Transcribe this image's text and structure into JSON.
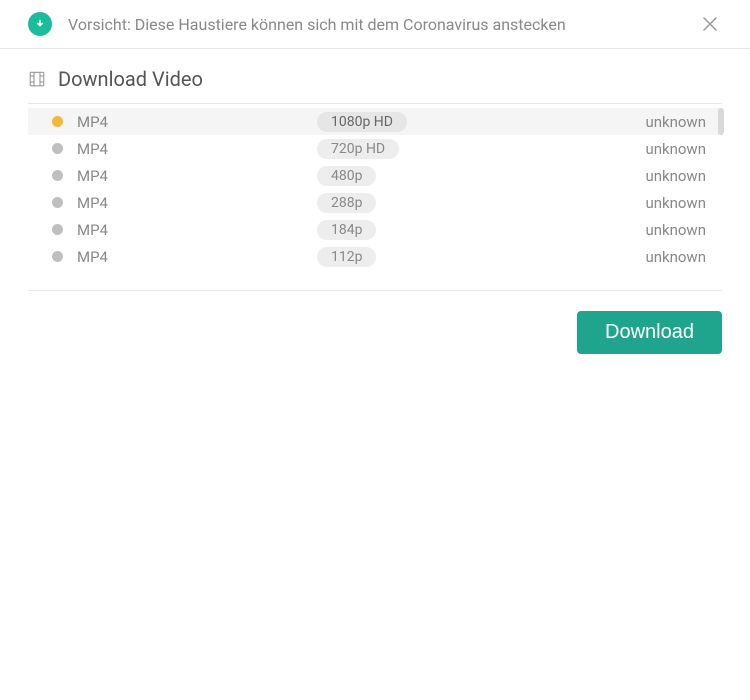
{
  "header": {
    "title": "Vorsicht: Diese Haustiere können sich mit dem Coronavirus anstecken"
  },
  "section": {
    "title": "Download Video"
  },
  "options": [
    {
      "format": "MP4",
      "quality": "1080p HD",
      "size": "unknown",
      "selected": true
    },
    {
      "format": "MP4",
      "quality": "720p HD",
      "size": "unknown",
      "selected": false
    },
    {
      "format": "MP4",
      "quality": "480p",
      "size": "unknown",
      "selected": false
    },
    {
      "format": "MP4",
      "quality": "288p",
      "size": "unknown",
      "selected": false
    },
    {
      "format": "MP4",
      "quality": "184p",
      "size": "unknown",
      "selected": false
    },
    {
      "format": "MP4",
      "quality": "112p",
      "size": "unknown",
      "selected": false
    }
  ],
  "footer": {
    "download_label": "Download"
  }
}
